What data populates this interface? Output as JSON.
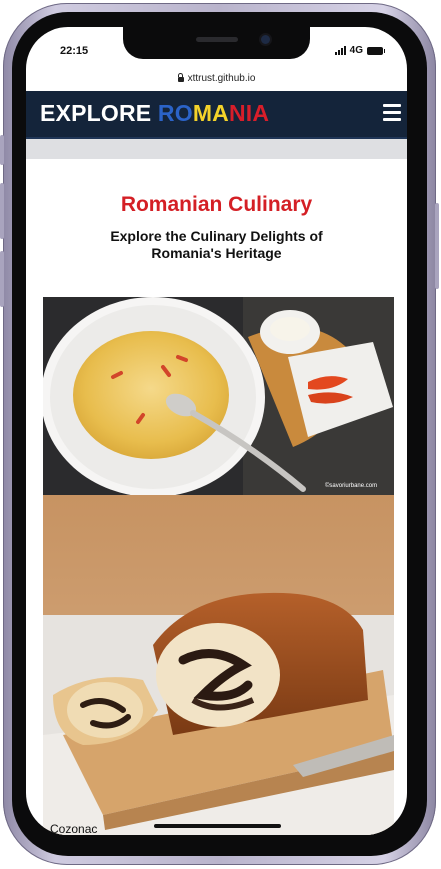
{
  "status_bar": {
    "time": "22:15",
    "network": "4G"
  },
  "browser": {
    "url": "xttrust.github.io"
  },
  "navbar": {
    "brand_part1": "EXPLORE ",
    "brand_blue": "RO",
    "brand_yellow": "MA",
    "brand_red": "NIA",
    "menu_icon": "hamburger-menu-icon"
  },
  "page": {
    "title": "Romanian Culinary",
    "subtitle": "Explore the Culinary Delights of Romania's Heritage"
  },
  "dishes": [
    {
      "image_credit": "©savoriurbane.com",
      "image_desc": "soup-bowl-photo"
    },
    {
      "caption": "Cozonac",
      "image_desc": "cozonac-bread-photo"
    }
  ],
  "colors": {
    "navbar_bg": "#14243a",
    "brand_blue": "#2b63c8",
    "brand_yellow": "#f3d22a",
    "brand_red": "#d81e2a",
    "title_red": "#d41f25"
  }
}
